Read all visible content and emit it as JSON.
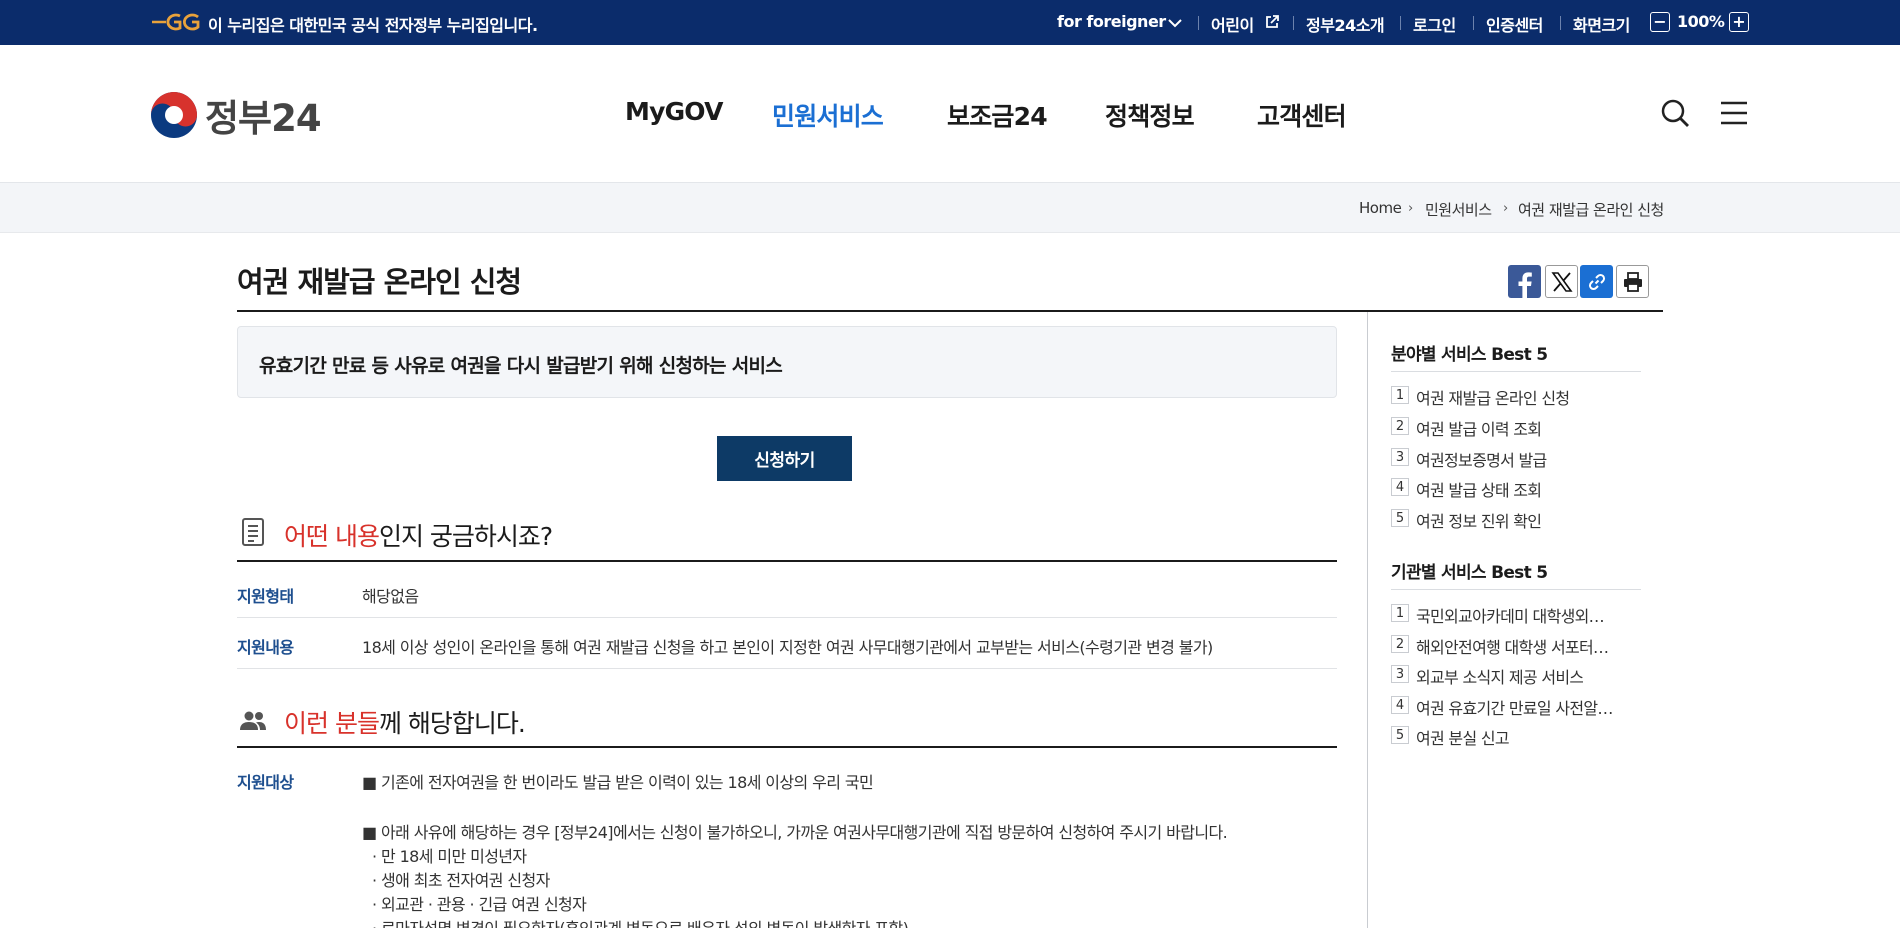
{
  "gov_bar": {
    "notice": "이 누리집은 대한민국 공식 전자정부 누리집입니다.",
    "for_foreigner": "for foreigner",
    "kids": "어린이",
    "about": "정부24소개",
    "login": "로그인",
    "cert": "인증센터",
    "zoom_label": "화면크기",
    "zoom_value": "100%",
    "zoom_out": "−",
    "zoom_in": "+"
  },
  "header": {
    "logo": "정부24",
    "nav": [
      "MyGOV",
      "민원서비스",
      "보조금24",
      "정책정보",
      "고객센터"
    ],
    "active_nav": "민원서비스"
  },
  "breadcrumb": [
    "Home",
    "민원서비스",
    "여권 재발급 온라인 신청"
  ],
  "page": {
    "title": "여권 재발급 온라인 신청",
    "summary": "유효기간 만료 등 사유로 여권을 다시 발급받기 위해 신청하는 서비스",
    "apply_button": "신청하기"
  },
  "section1": {
    "title_highlight": "어떤 내용",
    "title_rest": "인지 궁금하시죠?",
    "rows": [
      {
        "label": "지원형태",
        "value": "해당없음"
      },
      {
        "label": "지원내용",
        "value": "18세 이상 성인이 온라인을 통해 여권 재발급 신청을 하고 본인이 지정한 여권 사무대행기관에서 교부받는 서비스(수령기관 변경 불가)"
      }
    ]
  },
  "section2": {
    "title_highlight": "이런 분들",
    "title_rest": "께 해당합니다.",
    "label": "지원대상",
    "lines": [
      "■ 기존에 전자여권을 한 번이라도 발급 받은 이력이 있는 18세 이상의 우리 국민",
      "■ 아래 사유에 해당하는 경우 [정부24]에서는 신청이 불가하오니, 가까운 여권사무대행기관에 직접 방문하여 신청하여 주시기 바랍니다.",
      "· 만 18세 미만 미성년자",
      "· 생애 최초 전자여권 신청자",
      "· 외교관 · 관용 · 긴급 여권 신청자",
      "· 로마자성명 변경이 필요한자(혼인관계 변동으로 배우자 성의 변동이 발생한자 포함)"
    ]
  },
  "sidebar": {
    "best_by_field": {
      "title": "분야별 서비스 Best 5",
      "items": [
        "여권 재발급 온라인 신청",
        "여권 발급 이력 조회",
        "여권정보증명서 발급",
        "여권 발급 상태 조회",
        "여권 정보 진위 확인"
      ]
    },
    "best_by_agency": {
      "title": "기관별 서비스 Best 5",
      "items": [
        "국민외교아카데미 대학생외교…",
        "해외안전여행 대학생 서포터스…",
        "외교부 소식지 제공 서비스",
        "여권 유효기간 만료일 사전알…",
        "여권 분실 신고"
      ]
    }
  },
  "colors": {
    "gov_bar": "#0b2c6b",
    "active_nav": "#1b6fd3",
    "highlight": "#d8322b",
    "label": "#1e4f8f",
    "button": "#0d3a66"
  },
  "icons": [
    "search-icon",
    "menu-icon",
    "facebook-icon",
    "x-icon",
    "link-icon",
    "print-icon",
    "document-icon",
    "people-icon",
    "external-link-icon",
    "chevron-down-icon"
  ]
}
